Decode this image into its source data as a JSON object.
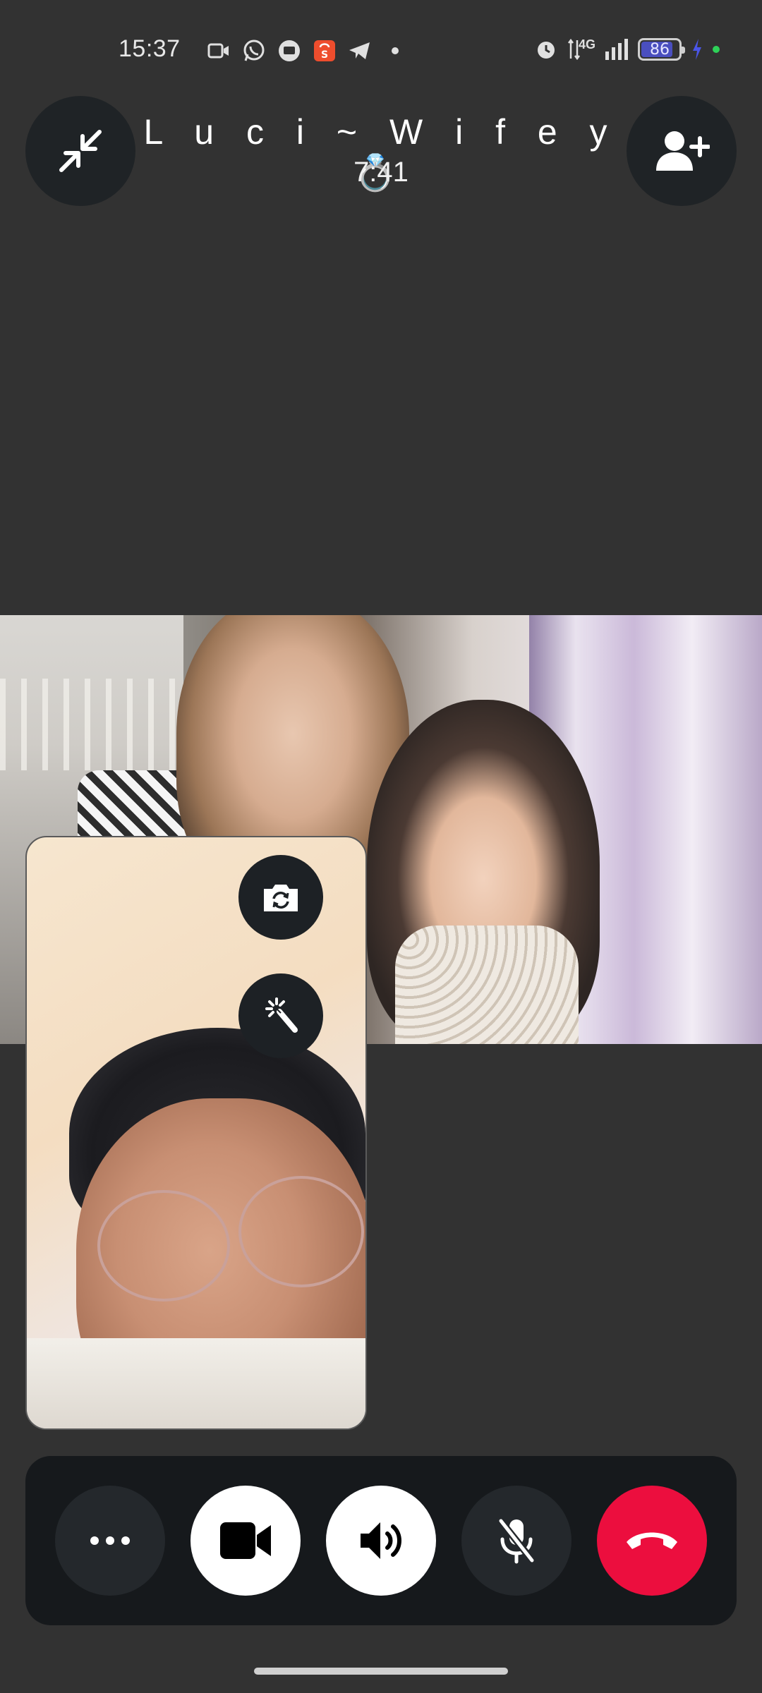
{
  "status_bar": {
    "time": "15:37",
    "left_icons": [
      "video-call-icon",
      "whatsapp-icon",
      "message-bubble-icon",
      "shopee-icon",
      "telegram-icon",
      "more-dot-icon"
    ],
    "right_icons": [
      "alarm-icon",
      "signal-4g-icon",
      "signal-bars-icon"
    ],
    "network_label": "4G",
    "battery_percent": "86",
    "battery_level": 0.86,
    "charging": true
  },
  "call": {
    "contact_name": "L u c i ~ W i f e y 💍",
    "elapsed": "7:41"
  },
  "controls": {
    "more": "more-icon",
    "video": "video-camera-icon",
    "speaker": "speaker-icon",
    "mic": "mic-muted-icon",
    "end": "end-call-icon"
  },
  "colors": {
    "background": "#323232",
    "button_dark": "#1f2326",
    "end_call": "#ec0e3e",
    "battery_fill": "#4a4fbf",
    "status_dot": "#2ed158"
  }
}
